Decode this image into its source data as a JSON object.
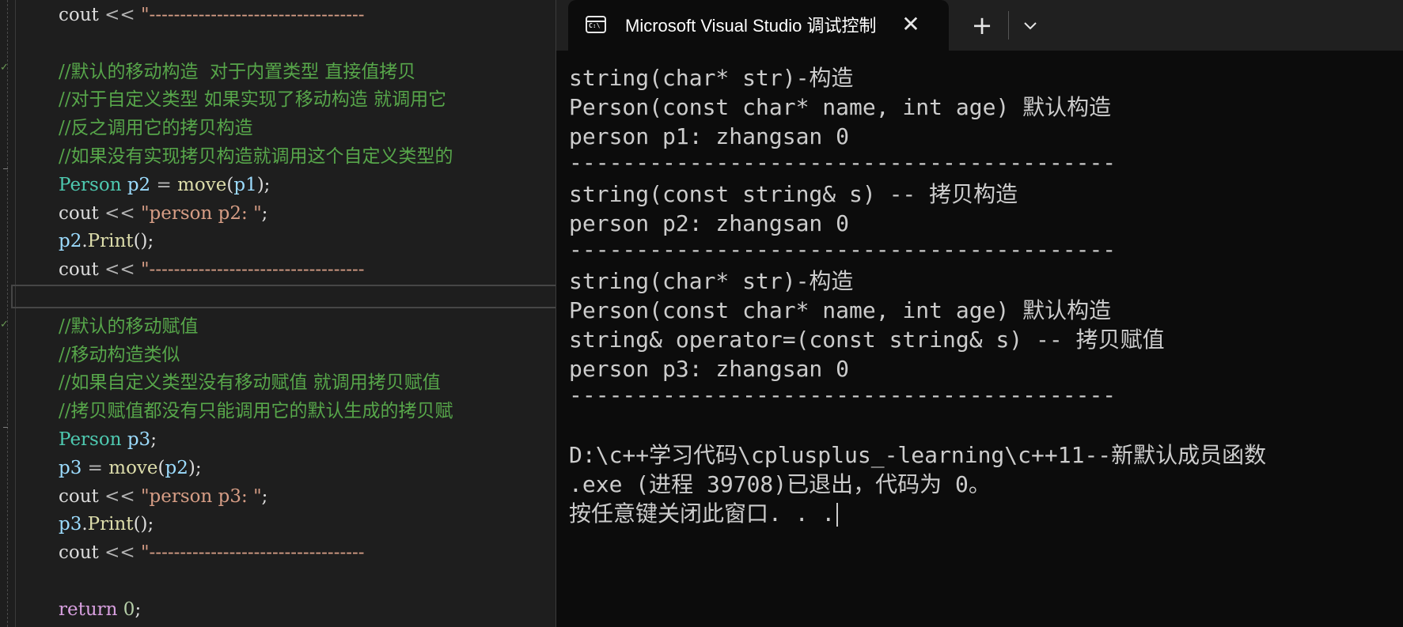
{
  "editor": {
    "lines": [
      [
        {
          "t": "cout",
          "c": "plain"
        },
        {
          "t": " << ",
          "c": "op"
        },
        {
          "t": "\"-----------------------------------",
          "c": "str"
        }
      ],
      [],
      [
        {
          "t": "//默认的移动构造  对于内置类型 直接值拷贝",
          "c": "comment"
        }
      ],
      [
        {
          "t": "//对于自定义类型 如果实现了移动构造 就调用它",
          "c": "comment"
        }
      ],
      [
        {
          "t": "//反之调用它的拷贝构造",
          "c": "comment"
        }
      ],
      [
        {
          "t": "//如果没有实现拷贝构造就调用这个自定义类型的",
          "c": "comment"
        }
      ],
      [
        {
          "t": "Person",
          "c": "type"
        },
        {
          "t": " ",
          "c": "plain"
        },
        {
          "t": "p2",
          "c": "var"
        },
        {
          "t": " = ",
          "c": "op"
        },
        {
          "t": "move",
          "c": "func"
        },
        {
          "t": "(",
          "c": "plain"
        },
        {
          "t": "p1",
          "c": "var"
        },
        {
          "t": ");",
          "c": "plain"
        }
      ],
      [
        {
          "t": "cout",
          "c": "plain"
        },
        {
          "t": " << ",
          "c": "op"
        },
        {
          "t": "\"person p2: \"",
          "c": "str"
        },
        {
          "t": ";",
          "c": "plain"
        }
      ],
      [
        {
          "t": "p2",
          "c": "var"
        },
        {
          "t": ".",
          "c": "plain"
        },
        {
          "t": "Print",
          "c": "func"
        },
        {
          "t": "();",
          "c": "plain"
        }
      ],
      [
        {
          "t": "cout",
          "c": "plain"
        },
        {
          "t": " << ",
          "c": "op"
        },
        {
          "t": "\"-----------------------------------",
          "c": "str"
        }
      ],
      [],
      [
        {
          "t": "//默认的移动赋值",
          "c": "comment"
        }
      ],
      [
        {
          "t": "//移动构造类似",
          "c": "comment"
        }
      ],
      [
        {
          "t": "//如果自定义类型没有移动赋值 就调用拷贝赋值",
          "c": "comment"
        }
      ],
      [
        {
          "t": "//拷贝赋值都没有只能调用它的默认生成的拷贝赋",
          "c": "comment"
        }
      ],
      [
        {
          "t": "Person",
          "c": "type"
        },
        {
          "t": " ",
          "c": "plain"
        },
        {
          "t": "p3",
          "c": "var"
        },
        {
          "t": ";",
          "c": "plain"
        }
      ],
      [
        {
          "t": "p3",
          "c": "var"
        },
        {
          "t": " = ",
          "c": "op"
        },
        {
          "t": "move",
          "c": "func"
        },
        {
          "t": "(",
          "c": "plain"
        },
        {
          "t": "p2",
          "c": "var"
        },
        {
          "t": ");",
          "c": "plain"
        }
      ],
      [
        {
          "t": "cout",
          "c": "plain"
        },
        {
          "t": " << ",
          "c": "op"
        },
        {
          "t": "\"person p3: \"",
          "c": "str"
        },
        {
          "t": ";",
          "c": "plain"
        }
      ],
      [
        {
          "t": "p3",
          "c": "var"
        },
        {
          "t": ".",
          "c": "plain"
        },
        {
          "t": "Print",
          "c": "func"
        },
        {
          "t": "();",
          "c": "plain"
        }
      ],
      [
        {
          "t": "cout",
          "c": "plain"
        },
        {
          "t": " << ",
          "c": "op"
        },
        {
          "t": "\"-----------------------------------",
          "c": "str"
        }
      ],
      [],
      [
        {
          "t": "return",
          "c": "kw"
        },
        {
          "t": " ",
          "c": "plain"
        },
        {
          "t": "0",
          "c": "num"
        },
        {
          "t": ";",
          "c": "plain"
        }
      ]
    ],
    "colors": {
      "background": "#1e1e1e",
      "comment": "#57a64a",
      "type": "#4ec9b0",
      "var": "#9cdcfe",
      "func": "#dcdcaa",
      "str": "#d69d85",
      "num": "#b5cea8",
      "kw": "#d8a0df"
    }
  },
  "terminal": {
    "tab": {
      "icon": "console-icon",
      "icon_text": "C:\\",
      "title": "Microsoft Visual Studio 调试控制台",
      "close_glyph": "✕"
    },
    "new_tab_glyph": "+",
    "dropdown_icon": "chevron-down-icon",
    "lines": [
      "string(char* str)-构造",
      "Person(const char* name, int age) 默认构造",
      "person p1: zhangsan 0",
      "-----------------------------------------",
      "string(const string& s) -- 拷贝构造",
      "person p2: zhangsan 0",
      "-----------------------------------------",
      "string(char* str)-构造",
      "Person(const char* name, int age) 默认构造",
      "string& operator=(const string& s) -- 拷贝赋值",
      "person p3: zhangsan 0",
      "-----------------------------------------",
      "",
      "D:\\c++学习代码\\cplusplus_-learning\\c++11--新默认成员函数",
      ".exe (进程 39708)已退出，代码为 0。",
      "按任意键关闭此窗口. . ."
    ],
    "colors": {
      "background": "#0c0c0c",
      "text": "#cccccc",
      "tabbar": "#202020"
    }
  }
}
